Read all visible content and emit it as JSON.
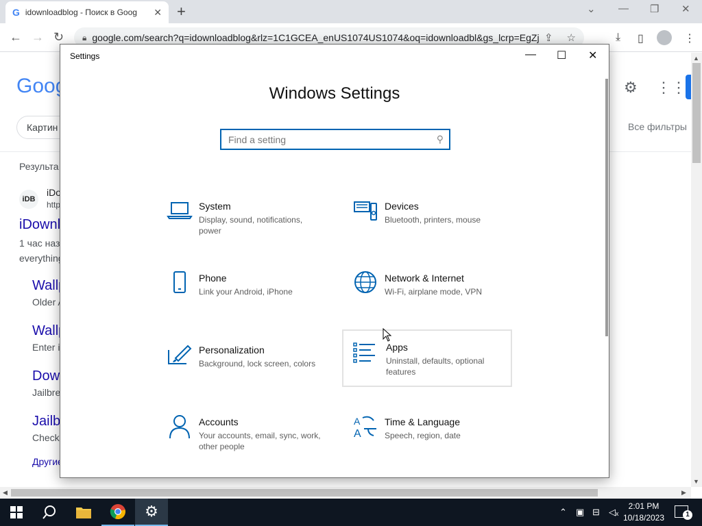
{
  "browser": {
    "tab_icon": "G",
    "tab_title": "idownloadblog - Поиск в Goog",
    "tab_close": "✕",
    "new_tab": "+",
    "url": "google.com/search?q=idownloadblog&rlz=1C1GCEA_enUS1074US1074&oq=idownloadbl&gs_lcrp=EgZja..."
  },
  "google": {
    "logo": "Goog",
    "chip": "Картин",
    "results_label": "Результа",
    "site_badge": "iDB",
    "site_name": "iDo",
    "site_url": "http",
    "main_link": "iDownl",
    "snippet1": "1 час наз",
    "snippet2": "everything",
    "sub_links": [
      {
        "title": "Wallp",
        "desc": "Older A"
      },
      {
        "title": "Wallp",
        "desc": "Enter i"
      },
      {
        "title": "Dow",
        "desc": "Jailbre"
      },
      {
        "title": "Jailb",
        "desc": "Check"
      }
    ],
    "more": "Другие",
    "filters": "Все фильтры"
  },
  "settings": {
    "title": "Settings",
    "heading": "Windows Settings",
    "search_placeholder": "Find a setting",
    "tiles": [
      {
        "name": "System",
        "desc": "Display, sound, notifications, power",
        "icon": "laptop-icon"
      },
      {
        "name": "Devices",
        "desc": "Bluetooth, printers, mouse",
        "icon": "devices-icon"
      },
      {
        "name": "Phone",
        "desc": "Link your Android, iPhone",
        "icon": "phone-icon"
      },
      {
        "name": "Network & Internet",
        "desc": "Wi-Fi, airplane mode, VPN",
        "icon": "globe-icon"
      },
      {
        "name": "Personalization",
        "desc": "Background, lock screen, colors",
        "icon": "paint-icon"
      },
      {
        "name": "Apps",
        "desc": "Uninstall, defaults, optional features",
        "icon": "apps-list-icon"
      },
      {
        "name": "Accounts",
        "desc": "Your accounts, email, sync, work, other people",
        "icon": "person-icon"
      },
      {
        "name": "Time & Language",
        "desc": "Speech, region, date",
        "icon": "time-language-icon"
      }
    ]
  },
  "taskbar": {
    "time": "2:01 PM",
    "date": "10/18/2023",
    "notifications_count": "1"
  },
  "colors": {
    "accent": "#0063b1",
    "taskbar": "#0e1621"
  }
}
